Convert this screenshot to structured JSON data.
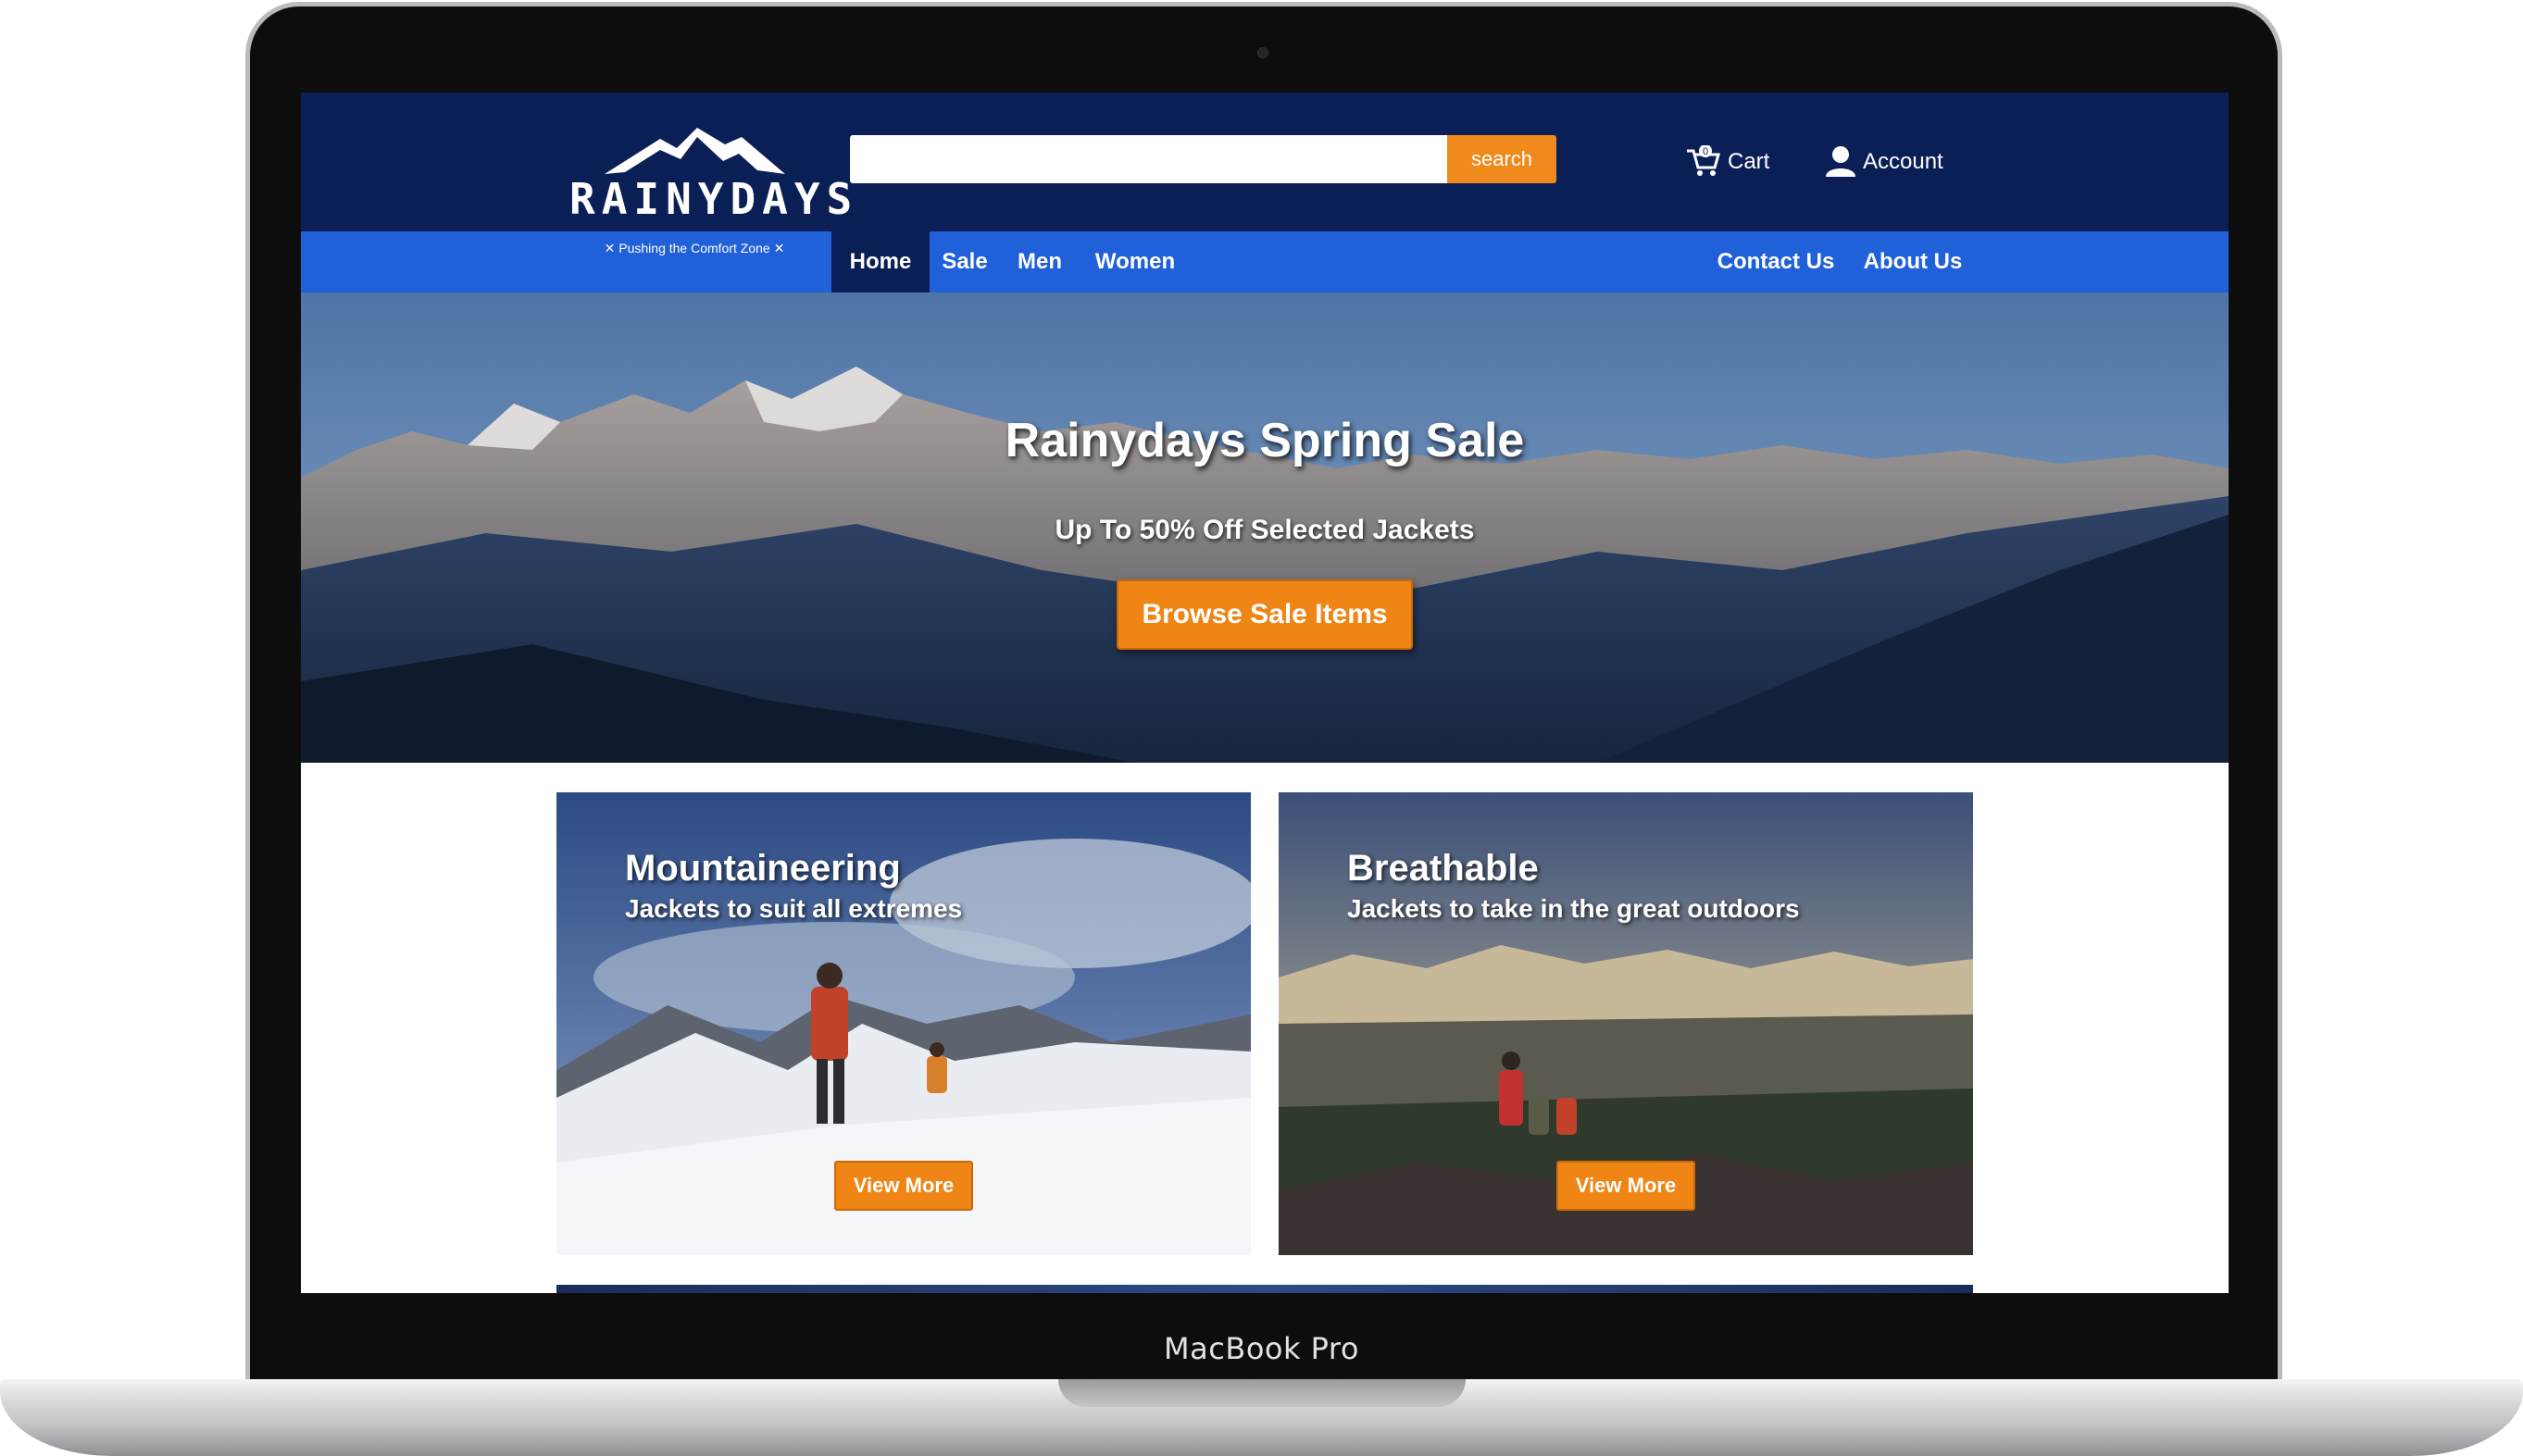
{
  "device": {
    "label": "MacBook Pro"
  },
  "site": {
    "logo_text": "RAINYDAYS",
    "tagline": "✕ Pushing the Comfort Zone ✕",
    "colors": {
      "header": "#0b1f57",
      "nav": "#2060d8",
      "accent": "#ef8515"
    }
  },
  "search": {
    "placeholder": "",
    "value": "",
    "button_label": "search"
  },
  "header_actions": {
    "cart_label": "Cart",
    "cart_count": "0",
    "account_label": "Account"
  },
  "nav": {
    "items": [
      {
        "label": "Home",
        "active": true
      },
      {
        "label": "Sale"
      },
      {
        "label": "Men"
      },
      {
        "label": "Women"
      }
    ],
    "right_items": [
      {
        "label": "Contact Us"
      },
      {
        "label": "About Us"
      }
    ]
  },
  "hero": {
    "title": "Rainydays Spring Sale",
    "subtitle": "Up To 50% Off Selected Jackets",
    "button_label": "Browse Sale Items"
  },
  "cards": [
    {
      "title": "Mountaineering",
      "subtitle": "Jackets to suit all extremes",
      "button_label": "View More"
    },
    {
      "title": "Breathable",
      "subtitle": "Jackets to take in the great outdoors",
      "button_label": "View More"
    }
  ]
}
